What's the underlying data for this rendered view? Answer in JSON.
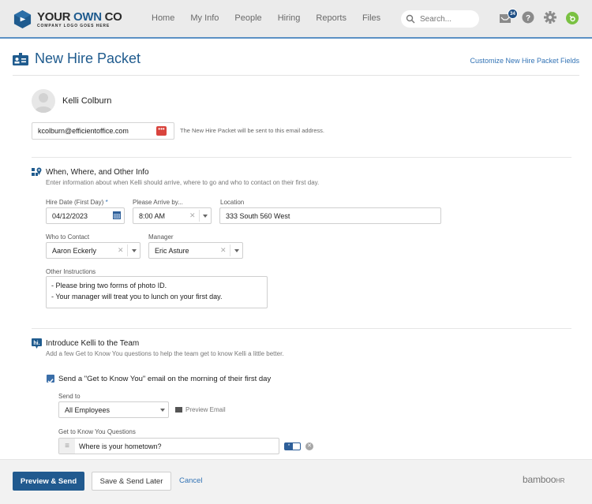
{
  "header": {
    "logo": {
      "title_part1": "YOUR ",
      "title_part2": "OWN",
      "title_part3": " CO",
      "subtitle": "COMPANY LOGO GOES HERE"
    },
    "nav": [
      "Home",
      "My Info",
      "People",
      "Hiring",
      "Reports",
      "Files"
    ],
    "search": {
      "placeholder": "Search..."
    },
    "inbox_badge": "34",
    "icons": [
      "inbox-icon",
      "help-icon",
      "settings-icon",
      "user-avatar"
    ]
  },
  "page": {
    "title": "New Hire Packet",
    "customize_link": "Customize New Hire Packet Fields"
  },
  "person": {
    "name": "Kelli Colburn",
    "email": "kcolburn@efficientoffice.com",
    "email_help": "The New Hire Packet will be sent to this email address."
  },
  "when_where": {
    "title": "When, Where, and Other Info",
    "description": "Enter information about when Kelli should arrive, where to go and who to contact on their first day.",
    "hire_date": {
      "label": "Hire Date (First Day)",
      "required_marker": "*",
      "value": "04/12/2023"
    },
    "arrive_by": {
      "label": "Please Arrive by...",
      "value": "8:00 AM"
    },
    "location": {
      "label": "Location",
      "value": "333 South 560 West"
    },
    "contact": {
      "label": "Who to Contact",
      "value": "Aaron Eckerly"
    },
    "manager": {
      "label": "Manager",
      "value": "Eric Asture"
    },
    "instructions": {
      "label": "Other Instructions",
      "lines": [
        "- Please bring two forms of photo ID.",
        "- Your manager will treat you to lunch on your first day."
      ]
    }
  },
  "introduce": {
    "title": "Introduce Kelli to the Team",
    "description": "Add a few Get to Know You questions to help the team get to know Kelli a little better.",
    "send_email_checkbox": {
      "label": "Send a \"Get to Know You\" email on the morning of their first day",
      "checked": true
    },
    "send_to": {
      "label": "Send to",
      "value": "All Employees"
    },
    "preview_email": "Preview Email",
    "questions_label": "Get to Know You Questions",
    "questions": [
      {
        "text": "Where is your hometown?",
        "required": true
      }
    ]
  },
  "footer": {
    "primary": "Preview & Send",
    "secondary": "Save & Send Later",
    "cancel": "Cancel",
    "brand": "bamboo",
    "brand_suffix": "HR"
  }
}
